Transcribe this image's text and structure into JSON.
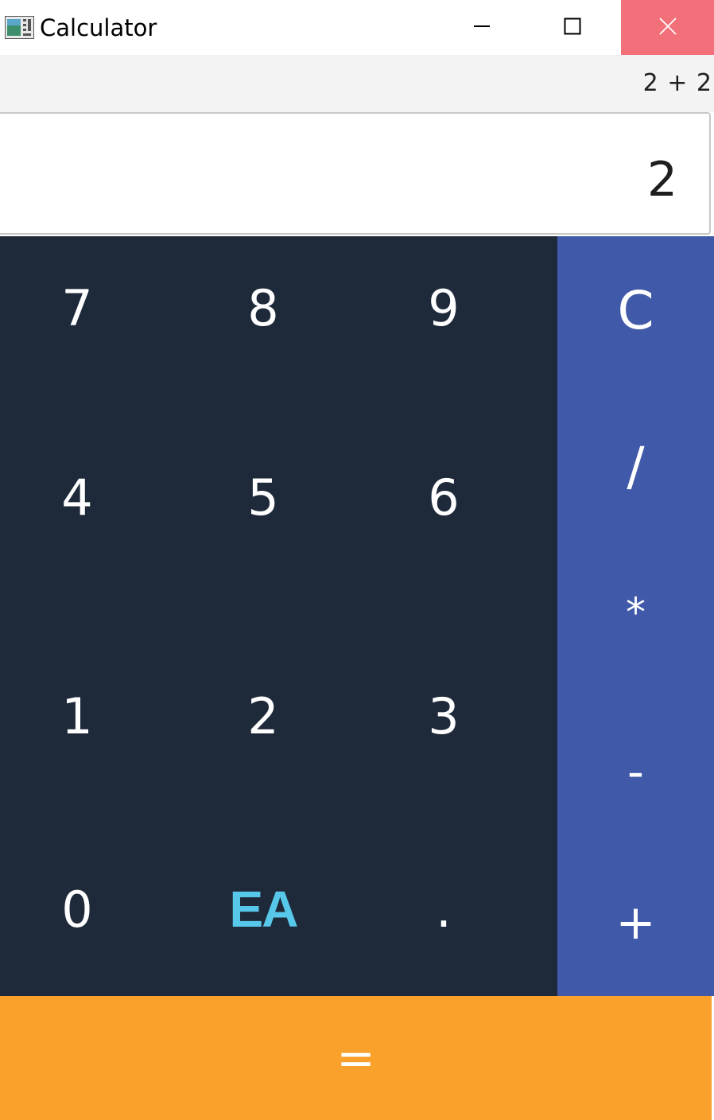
{
  "window": {
    "title": "Calculator",
    "icon": "calculator-app-icon",
    "controls": {
      "minimize": "minimize-icon",
      "maximize": "maximize-icon",
      "close": "close-icon"
    },
    "close_hover_color": "#f1707a"
  },
  "history": {
    "expression": "2 + 2"
  },
  "display": {
    "value": "2"
  },
  "keypad": {
    "row1": [
      "7",
      "8",
      "9"
    ],
    "row2": [
      "4",
      "5",
      "6"
    ],
    "row3": [
      "1",
      "2",
      "3"
    ],
    "row4": [
      "0",
      "EA",
      "."
    ]
  },
  "operators": {
    "clear": "C",
    "divide": "/",
    "multiply": "*",
    "subtract": "-",
    "add": "+"
  },
  "equals": "=",
  "colors": {
    "keypad_bg": "#1e2a3a",
    "operators_bg": "#4159a9",
    "equals_bg": "#f9a12b",
    "ea_logo": "#57c7ea"
  }
}
